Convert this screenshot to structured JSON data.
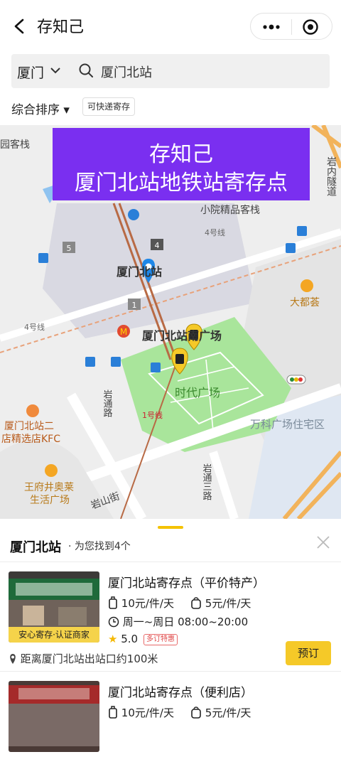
{
  "header": {
    "title": "存知己"
  },
  "search": {
    "city": "厦门",
    "query": "厦门北站"
  },
  "filters": {
    "sort": "综合排序 ▾",
    "tag": "可快递寄存"
  },
  "banner": {
    "line1": "存知己",
    "line2": "厦门北站地铁站寄存点"
  },
  "map": {
    "labels": {
      "hotel_left": "园客栈",
      "tunnel": "岩内隧道",
      "xiaoyuan": "小院精品客栈",
      "line4_a": "4号线",
      "line4_b": "4号线",
      "gate5": "5",
      "gate4": "4",
      "gate1": "1",
      "station": "厦门北站",
      "square": "厦门北站南广场",
      "dadu": "大都荟",
      "yantong": "岩通路",
      "times": "时代广场",
      "line1": "1号线",
      "wanke": "万科广场住宅区",
      "kfc1": "厦门北站二",
      "kfc2": "店精选店KFC",
      "yantong3": "岩通三路",
      "outlet1": "王府井奥莱",
      "outlet2": "生活广场",
      "yanshan": "岩山街"
    }
  },
  "sheet": {
    "title": "厦门北站",
    "count": "· 为您找到4个"
  },
  "listings": [
    {
      "name": "厦门北站寄存点（平价特产）",
      "price1": "10元/件/天",
      "price2": "5元/件/天",
      "hours": "周一~周日 08:00~20:00",
      "rating": "5.0",
      "discount": "多订特惠",
      "badge": "安心寄存·认证商家",
      "distance": "距离厦门北站出站口约100米",
      "book": "预订"
    },
    {
      "name": "厦门北站寄存点（便利店）",
      "price1": "10元/件/天",
      "price2": "5元/件/天"
    }
  ],
  "colors": {
    "accent": "#f5c928",
    "banner": "#7a2ff0"
  }
}
